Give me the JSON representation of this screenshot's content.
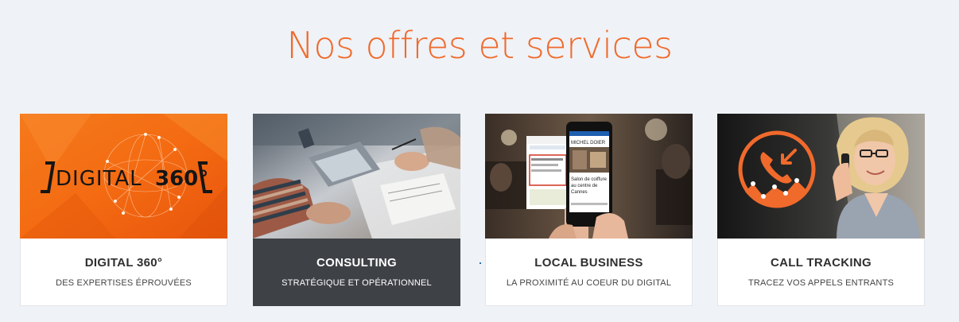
{
  "title": "Nos offres et services",
  "cards": [
    {
      "title": "DIGITAL 360°",
      "subtitle": "DES EXPERTISES ÉPROUVÉES",
      "logo_word": "DIGITAL",
      "logo_num": "360°"
    },
    {
      "title": "CONSULTING",
      "subtitle": "STRATÉGIQUE ET OPÉRATIONNEL"
    },
    {
      "title": "LOCAL BUSINESS",
      "subtitle": "LA PROXIMITÉ AU COEUR DU DIGITAL",
      "phone_brand": "MICHEL DOIER",
      "phone_text1": "Salon de coiffure",
      "phone_text2": "au centre de",
      "phone_text3": "Cannes"
    },
    {
      "title": "CALL TRACKING",
      "subtitle": "TRACEZ VOS APPELS ENTRANTS"
    }
  ],
  "colors": {
    "accent": "#f06a2c",
    "active_card": "#3e4146",
    "background": "#eff2f6"
  }
}
